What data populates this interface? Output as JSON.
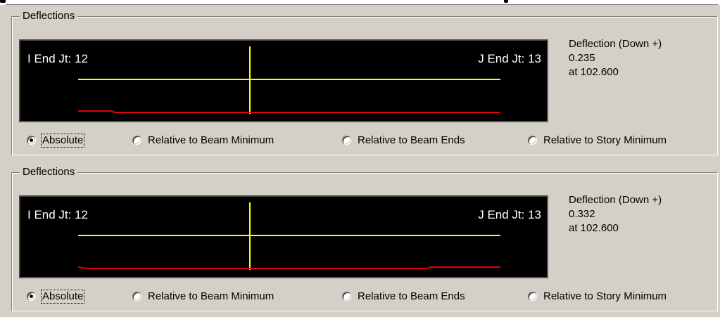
{
  "panels": [
    {
      "title": "Deflections",
      "i_end_label": "I End Jt: 12",
      "j_end_label": "J End Jt: 13",
      "deflection_title": "Deflection (Down +)",
      "deflection_value": "0.235",
      "deflection_at": "at 102.600",
      "selected_option": "Absolute",
      "options": [
        "Absolute",
        "Relative to Beam Minimum",
        "Relative to Beam Ends",
        "Relative to Story Minimum"
      ]
    },
    {
      "title": "Deflections",
      "i_end_label": "I End Jt: 12",
      "j_end_label": "J End Jt: 13",
      "deflection_title": "Deflection (Down +)",
      "deflection_value": "0.332",
      "deflection_at": "at 102.600",
      "selected_option": "Absolute",
      "options": [
        "Absolute",
        "Relative to Beam Minimum",
        "Relative to Beam Ends",
        "Relative to Story Minimum"
      ]
    }
  ],
  "colors": {
    "plot_background": "#000000",
    "beam_line": "#ffff00",
    "deflection_curve": "#e00000",
    "window": "#d4d0c8"
  }
}
